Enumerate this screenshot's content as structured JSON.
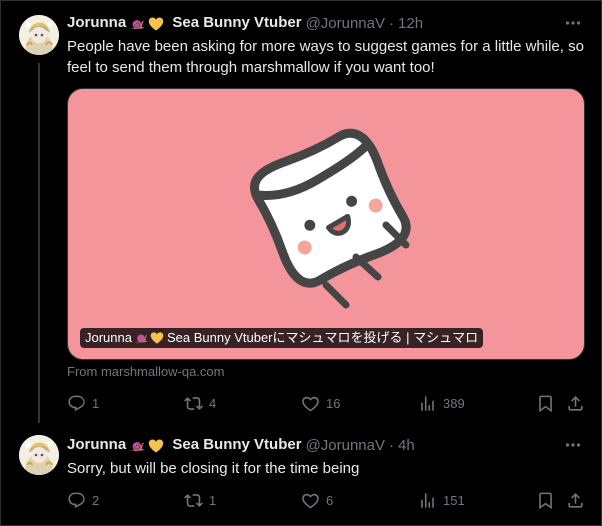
{
  "colors": {
    "background": "#000000",
    "text_primary": "#e7e9ea",
    "text_secondary": "#71767b",
    "card_background": "#f4959b",
    "emoji_heart": "#f6c24a"
  },
  "tweets": [
    {
      "display_name": "Jorunna",
      "display_name_suffix": "Sea Bunny Vtuber",
      "handle": "@JorunnaV",
      "separator": "·",
      "time": "12h",
      "text": "People have been asking for more ways to suggest games for a little while, so feel to send them through marshmallow if you want too!",
      "card": {
        "title_prefix": "Jorunna",
        "title_suffix": "Sea Bunny Vtuberにマシュマロを投げる | マシュマロ",
        "source": "From marshmallow-qa.com",
        "image_icon": "marshmallow-mascot-icon"
      },
      "actions": {
        "replies": "1",
        "reposts": "4",
        "likes": "16",
        "views": "389"
      }
    },
    {
      "display_name": "Jorunna",
      "display_name_suffix": "Sea Bunny Vtuber",
      "handle": "@JorunnaV",
      "separator": "·",
      "time": "4h",
      "text": "Sorry, but will be closing it for the time being",
      "actions": {
        "replies": "2",
        "reposts": "1",
        "likes": "6",
        "views": "151"
      }
    }
  ],
  "icons": {
    "emoji_1": "snail-emoji-icon",
    "emoji_2": "yellow-heart-emoji-icon",
    "more": "more-icon",
    "reply": "reply-icon",
    "repost": "repost-icon",
    "like": "like-icon",
    "views": "views-icon",
    "bookmark": "bookmark-icon",
    "share": "share-icon"
  }
}
